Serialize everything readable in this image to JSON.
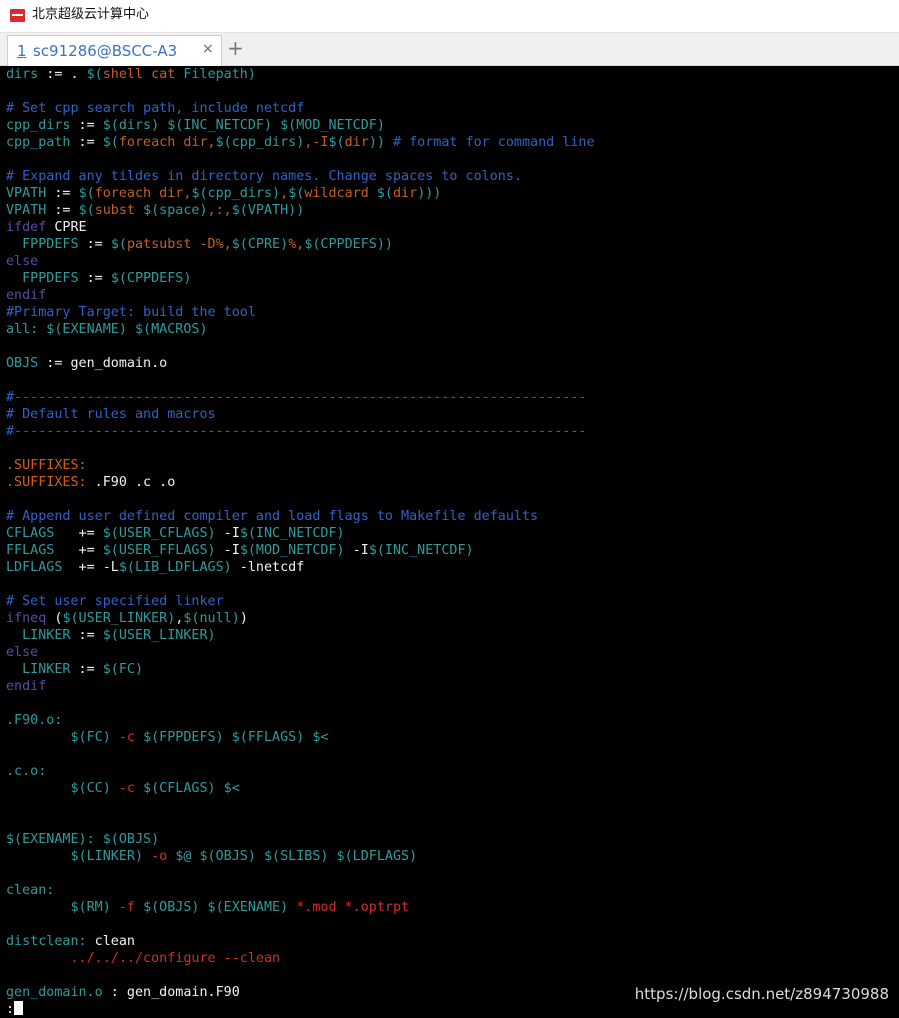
{
  "window": {
    "title": "北京超级云计算中心"
  },
  "tabs": [
    {
      "index": "1",
      "label": "sc91286@BSCC-A3",
      "close": "×"
    }
  ],
  "new_tab": "+",
  "terminal": {
    "lines": [
      [
        [
          "var",
          "dirs"
        ],
        [
          "white",
          " := . "
        ],
        [
          "var",
          "$("
        ],
        [
          "func",
          "shell cat "
        ],
        [
          "var",
          "Filepath)"
        ]
      ],
      [],
      [
        [
          "comment",
          "# Set cpp search path, include netcdf"
        ]
      ],
      [
        [
          "var",
          "cpp_dirs"
        ],
        [
          "white",
          " := "
        ],
        [
          "var",
          "$(dirs) $(INC_NETCDF) $(MOD_NETCDF)"
        ]
      ],
      [
        [
          "var",
          "cpp_path"
        ],
        [
          "white",
          " := "
        ],
        [
          "var",
          "$("
        ],
        [
          "func",
          "foreach dir,"
        ],
        [
          "var",
          "$(cpp_dirs)"
        ],
        [
          "func",
          ",-I"
        ],
        [
          "var",
          "$("
        ],
        [
          "func",
          "dir"
        ],
        [
          "var",
          "))"
        ],
        [
          "comment",
          " # format for command line"
        ]
      ],
      [],
      [
        [
          "comment",
          "# Expand any tildes in directory names. Change spaces to colons."
        ]
      ],
      [
        [
          "var",
          "VPATH"
        ],
        [
          "white",
          " := "
        ],
        [
          "var",
          "$("
        ],
        [
          "func",
          "foreach dir,"
        ],
        [
          "var",
          "$(cpp_dirs)"
        ],
        [
          "func",
          ","
        ],
        [
          "var",
          "$("
        ],
        [
          "func",
          "wildcard "
        ],
        [
          "var",
          "$("
        ],
        [
          "func",
          "dir"
        ],
        [
          "var",
          ")))"
        ]
      ],
      [
        [
          "var",
          "VPATH"
        ],
        [
          "white",
          " := "
        ],
        [
          "var",
          "$("
        ],
        [
          "func",
          "subst "
        ],
        [
          "var",
          "$(space)"
        ],
        [
          "func",
          ",:,"
        ],
        [
          "var",
          "$(VPATH))"
        ]
      ],
      [
        [
          "cond",
          "ifdef"
        ],
        [
          "white",
          " CPRE"
        ]
      ],
      [
        [
          "var",
          "  FPPDEFS"
        ],
        [
          "white",
          " := "
        ],
        [
          "var",
          "$("
        ],
        [
          "func",
          "patsubst -D%,"
        ],
        [
          "var",
          "$(CPRE)"
        ],
        [
          "func",
          "%,"
        ],
        [
          "var",
          "$(CPPDEFS))"
        ]
      ],
      [
        [
          "cond",
          "else"
        ]
      ],
      [
        [
          "var",
          "  FPPDEFS"
        ],
        [
          "white",
          " := "
        ],
        [
          "var",
          "$(CPPDEFS)"
        ]
      ],
      [
        [
          "cond",
          "endif"
        ]
      ],
      [
        [
          "comment",
          "#Primary Target: build the tool"
        ]
      ],
      [
        [
          "var",
          "all: $(EXENAME) $(MACROS)"
        ]
      ],
      [],
      [
        [
          "var",
          "OBJS"
        ],
        [
          "white",
          " := gen_domain.o"
        ]
      ],
      [],
      [
        [
          "comment",
          "#-----------------------------------------------------------------------"
        ]
      ],
      [
        [
          "comment",
          "# Default rules and macros"
        ]
      ],
      [
        [
          "comment",
          "#-----------------------------------------------------------------------"
        ]
      ],
      [],
      [
        [
          "orange",
          ".SUFFIXES:"
        ]
      ],
      [
        [
          "orange",
          ".SUFFIXES:"
        ],
        [
          "white",
          " .F90 .c .o"
        ]
      ],
      [],
      [
        [
          "comment",
          "# Append user defined compiler and load flags to Makefile defaults"
        ]
      ],
      [
        [
          "var",
          "CFLAGS"
        ],
        [
          "white",
          "   += "
        ],
        [
          "var",
          "$(USER_CFLAGS)"
        ],
        [
          "white",
          " -I"
        ],
        [
          "var",
          "$(INC_NETCDF)"
        ]
      ],
      [
        [
          "var",
          "FFLAGS"
        ],
        [
          "white",
          "   += "
        ],
        [
          "var",
          "$(USER_FFLAGS)"
        ],
        [
          "white",
          " -I"
        ],
        [
          "var",
          "$(MOD_NETCDF)"
        ],
        [
          "white",
          " -I"
        ],
        [
          "var",
          "$(INC_NETCDF)"
        ]
      ],
      [
        [
          "var",
          "LDFLAGS"
        ],
        [
          "white",
          "  += -L"
        ],
        [
          "var",
          "$(LIB_LDFLAGS)"
        ],
        [
          "white",
          " -lnetcdf"
        ]
      ],
      [],
      [
        [
          "comment",
          "# Set user specified linker"
        ]
      ],
      [
        [
          "cond",
          "ifneq"
        ],
        [
          "white",
          " ("
        ],
        [
          "var",
          "$(USER_LINKER)"
        ],
        [
          "white",
          ","
        ],
        [
          "var",
          "$(null)"
        ],
        [
          "white",
          ")"
        ]
      ],
      [
        [
          "var",
          "  LINKER"
        ],
        [
          "white",
          " := "
        ],
        [
          "var",
          "$(USER_LINKER)"
        ]
      ],
      [
        [
          "cond",
          "else"
        ]
      ],
      [
        [
          "var",
          "  LINKER"
        ],
        [
          "white",
          " := "
        ],
        [
          "var",
          "$(FC)"
        ]
      ],
      [
        [
          "cond",
          "endif"
        ]
      ],
      [],
      [
        [
          "var",
          ".F90.o:"
        ]
      ],
      [
        [
          "var",
          "        $(FC)"
        ],
        [
          "red",
          " -c "
        ],
        [
          "var",
          "$(FPPDEFS) $(FFLAGS) $<"
        ]
      ],
      [],
      [
        [
          "var",
          ".c.o:"
        ]
      ],
      [
        [
          "var",
          "        $(CC)"
        ],
        [
          "red",
          " -c "
        ],
        [
          "var",
          "$(CFLAGS) $<"
        ]
      ],
      [],
      [],
      [
        [
          "var",
          "$(EXENAME): $(OBJS)"
        ]
      ],
      [
        [
          "var",
          "        $(LINKER)"
        ],
        [
          "red",
          " -o "
        ],
        [
          "var",
          "$@ $(OBJS) $(SLIBS) $(LDFLAGS)"
        ]
      ],
      [],
      [
        [
          "var",
          "clean:"
        ]
      ],
      [
        [
          "var",
          "        $(RM)"
        ],
        [
          "red",
          " -f "
        ],
        [
          "var",
          "$(OBJS) $(EXENAME)"
        ],
        [
          "red",
          " *.mod *.optrpt"
        ]
      ],
      [],
      [
        [
          "var",
          "distclean:"
        ],
        [
          "white",
          " clean"
        ]
      ],
      [
        [
          "red",
          "        ../../../configure --clean"
        ]
      ],
      [],
      [
        [
          "var",
          "gen_domain.o"
        ],
        [
          "white",
          " : gen_domain.F90"
        ]
      ],
      [
        [
          "white",
          ":"
        ],
        [
          "cursor",
          ""
        ]
      ]
    ]
  },
  "watermark": "https://blog.csdn.net/z894730988",
  "colors": {
    "comment": "#2f62c9",
    "variable": "#2e9c9c",
    "function": "#c35f22",
    "text": "#f2f2f2",
    "flag": "#d42b2b",
    "conditional": "#5d4b9f",
    "suffix": "#d45d1a"
  }
}
